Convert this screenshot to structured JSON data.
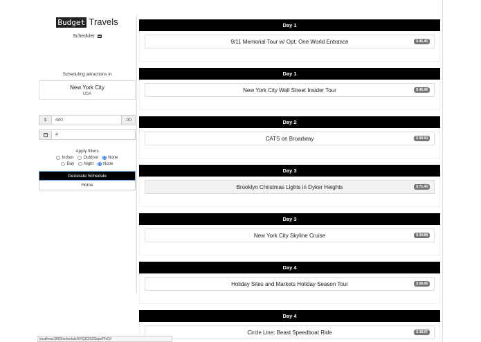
{
  "brand": {
    "box": "Budget",
    "rest": "Travels"
  },
  "sidebar": {
    "subtitle": "Scheduler",
    "scheduling_label": "Scheduling attractions in",
    "city": "New York City",
    "country": "USA",
    "budget": {
      "prefix": "$",
      "value": "400",
      "suffix": ".00"
    },
    "days": {
      "value": "4"
    },
    "filters_label": "Apply filters",
    "filter_row1": [
      "Indoor",
      "Outdoor",
      "None"
    ],
    "filter_row2": [
      "Day",
      "Night",
      "None"
    ],
    "generate_label": "Generate Schedule",
    "home_label": "Home"
  },
  "schedule": [
    {
      "day": "Day 1",
      "name": "9/11 Memorial Tour w/ Opt. One World Entrance",
      "price": "$ 45.46"
    },
    {
      "day": "Day 1",
      "name": "New York City Wall Street Insider Tour",
      "price": "$ 45.46"
    },
    {
      "day": "Day 2",
      "name": "CATS on Broadway",
      "price": "$ 99.93"
    },
    {
      "day": "Day 3",
      "name": "Brooklyn Christmas Lights in Dyker Heights",
      "price": "$ 71.44"
    },
    {
      "day": "Day 3",
      "name": "New York City Skyline Cruise",
      "price": "$ 34.88"
    },
    {
      "day": "Day 4",
      "name": "Holiday Sites and Markets Holiday Season Tour",
      "price": "$ 58.45"
    },
    {
      "day": "Day 4",
      "name": "Circle Line: Beast Speedboat Ride",
      "price": "$ 38.97"
    }
  ],
  "statusbar": "localhost:3000/schedule/XYQG3S2GejwFFrC#"
}
